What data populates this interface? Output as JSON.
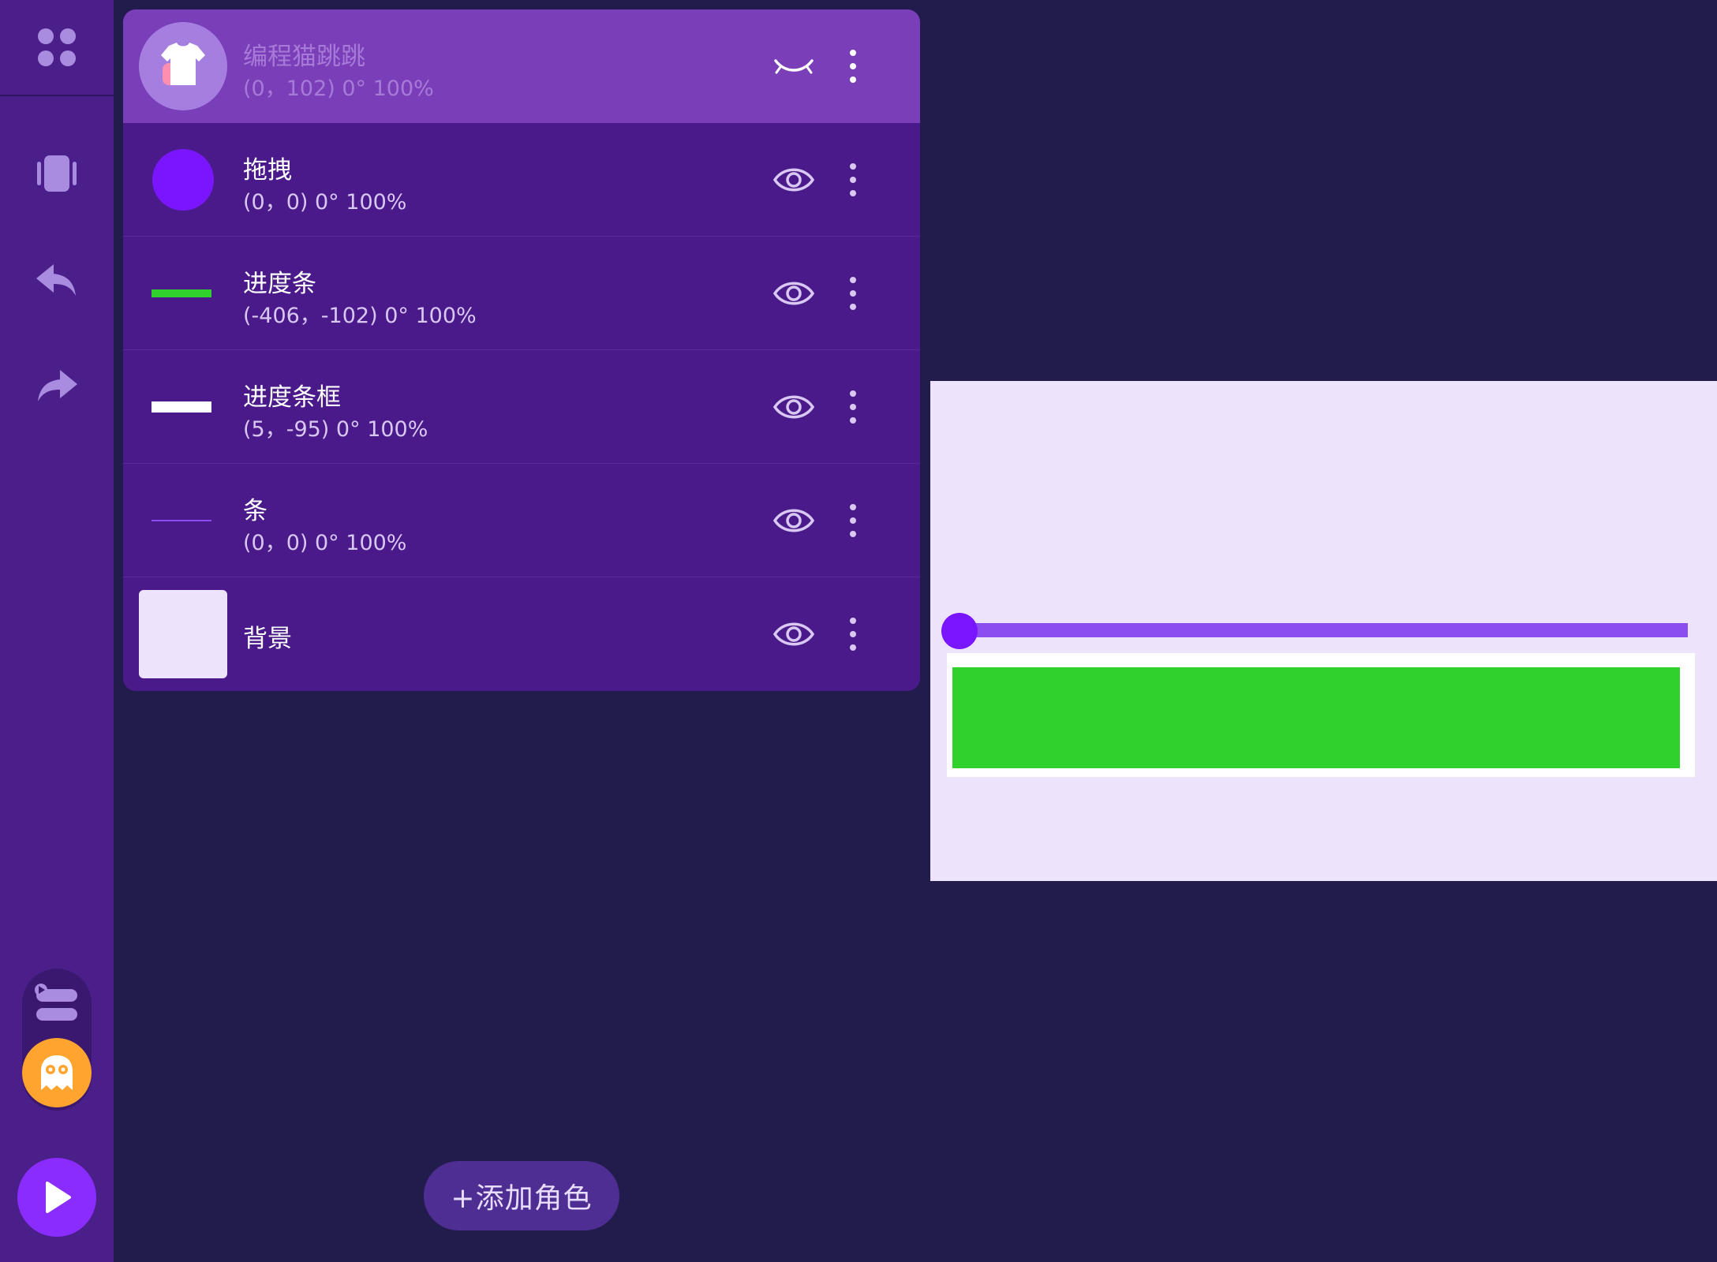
{
  "sprites": [
    {
      "name": "编程猫跳跳",
      "meta": "(0，102) 0° 100%",
      "thumb_icon": "shirt-icon",
      "hidden": true,
      "selected": true
    },
    {
      "name": "拖拽",
      "meta": "(0，0) 0° 100%",
      "thumb_icon": "purple-circle-icon",
      "hidden": false
    },
    {
      "name": "进度条",
      "meta": "(-406，-102) 0° 100%",
      "thumb_icon": "green-bar-icon",
      "hidden": false
    },
    {
      "name": "进度条框",
      "meta": "(5，-95) 0° 100%",
      "thumb_icon": "white-bar-icon",
      "hidden": false
    },
    {
      "name": "条",
      "meta": "(0，0) 0° 100%",
      "thumb_icon": "thin-line-icon",
      "hidden": false
    },
    {
      "name": "背景",
      "meta": "",
      "thumb_icon": "background-swatch-icon",
      "hidden": false
    }
  ],
  "add_sprite_label": "+添加角色",
  "colors": {
    "sidebar": "#4a1f8a",
    "panel": "#4a1a8a",
    "selected_row": "#7a3fb8",
    "canvas_bg": "#221c4d",
    "stage_bg": "#ede3fb",
    "progress_fill": "#2fd22c",
    "slider_track": "#8b4cf0",
    "slider_knob": "#7a16ff",
    "accent": "#8b2cff",
    "avatar": "#ffa42e"
  },
  "sidebar_icons": [
    "apps-grid-icon",
    "vibrate-device-icon",
    "undo-icon",
    "redo-icon",
    "blocks-icon",
    "ghost-avatar-icon",
    "play-icon"
  ]
}
